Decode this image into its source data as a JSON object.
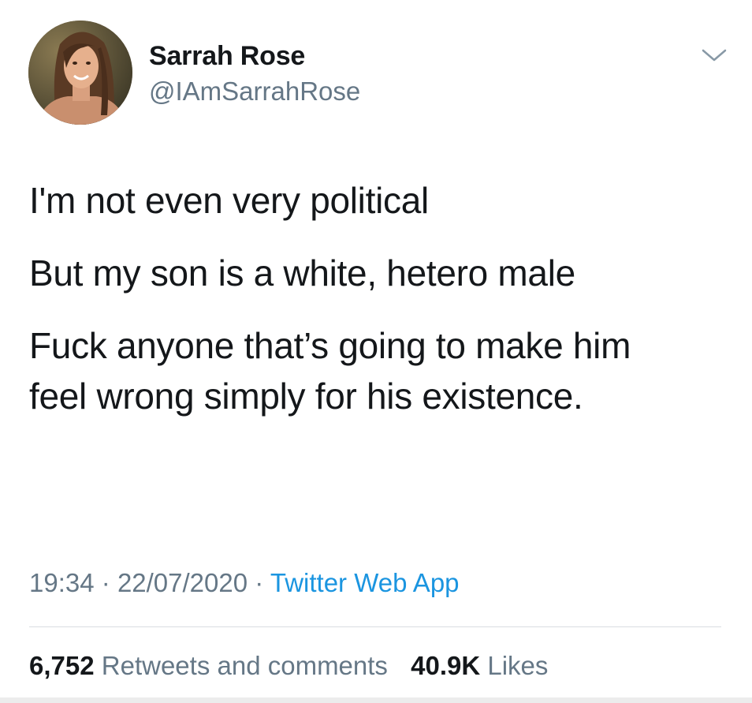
{
  "author": {
    "display_name": "Sarrah Rose",
    "handle": "@IAmSarrahRose"
  },
  "tweet": {
    "paragraphs": [
      "I'm not even very political",
      "But my son is a white, hetero male",
      "Fuck anyone that’s going to make him feel wrong simply for his existence."
    ],
    "time": "19:34",
    "date": "22/07/2020",
    "separator": "·",
    "source": "Twitter Web App"
  },
  "stats": {
    "retweets_count": "6,752",
    "retweets_label": "Retweets and comments",
    "likes_count": "40.9K",
    "likes_label": "Likes"
  },
  "icons": {
    "caret": "chevron-down-icon"
  },
  "colors": {
    "text_primary": "#14171a",
    "text_secondary": "#657786",
    "link": "#1b95e0",
    "divider": "#d9dde1"
  }
}
